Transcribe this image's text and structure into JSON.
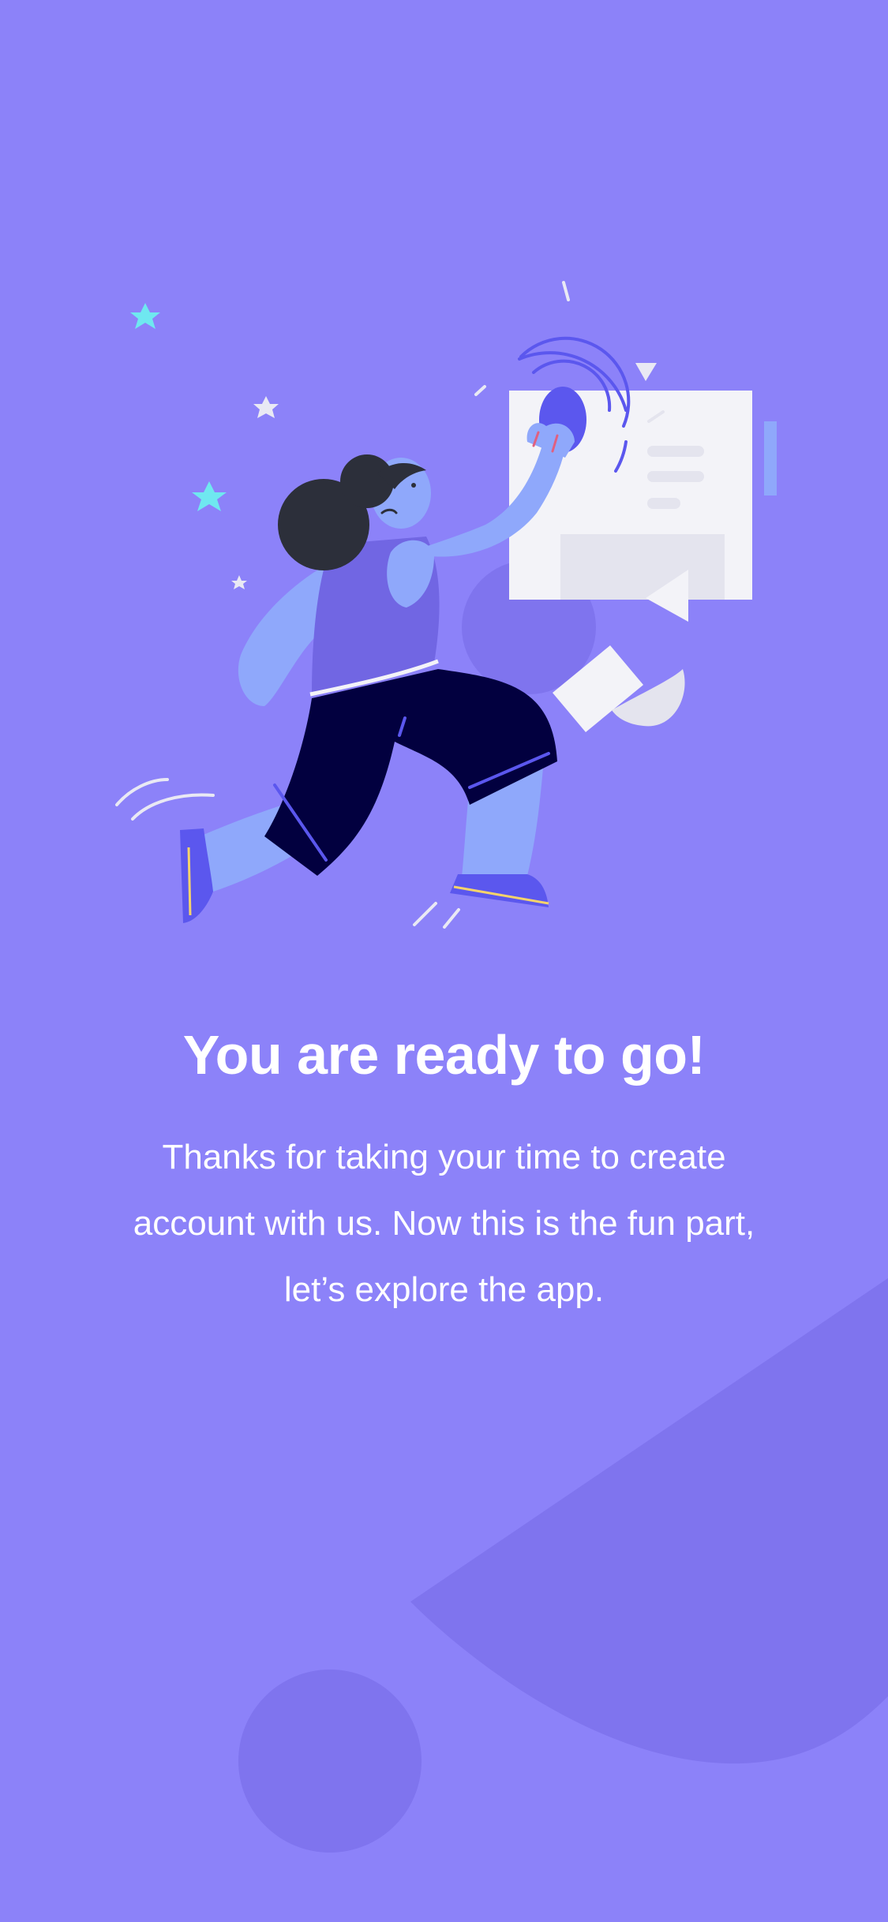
{
  "screen": {
    "headline": "You are ready to go!",
    "message": "Thanks for taking your time to create account with us. Now this is the fun part, let’s explore the app."
  },
  "illustration": {
    "subject": "person-pressing-button-illustration"
  },
  "colors": {
    "background": "#8C82F9",
    "decor_shape": "#7F74EE",
    "text": "#FFFFFF",
    "skin": "#8FA8FB",
    "shirt": "#7166E3",
    "shorts": "#02003F",
    "hair": "#2C2F3A",
    "card": "#F3F3F8",
    "star_cyan": "#6FE8F0"
  }
}
